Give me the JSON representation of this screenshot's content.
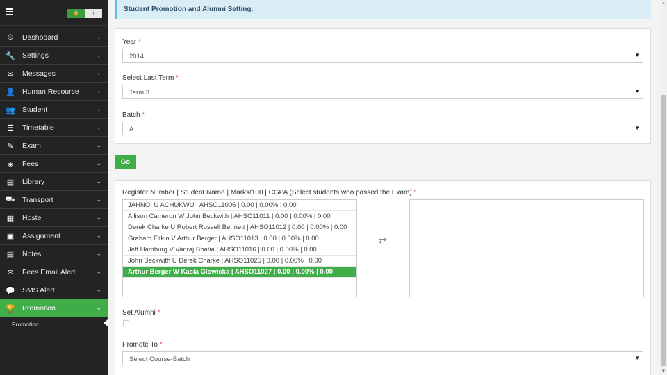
{
  "sidebar": {
    "items": [
      {
        "label": "Dashboard",
        "icon": "dashboard-icon",
        "glyph": "⏲"
      },
      {
        "label": "Settings",
        "icon": "wrench-icon",
        "glyph": "🔧"
      },
      {
        "label": "Messages",
        "icon": "envelope-icon",
        "glyph": "✉"
      },
      {
        "label": "Human Resource",
        "icon": "user-icon",
        "glyph": "👤"
      },
      {
        "label": "Student",
        "icon": "users-icon",
        "glyph": "👥"
      },
      {
        "label": "Timetable",
        "icon": "table-icon",
        "glyph": "☰"
      },
      {
        "label": "Exam",
        "icon": "edit-icon",
        "glyph": "✎"
      },
      {
        "label": "Fees",
        "icon": "tag-icon",
        "glyph": "◈"
      },
      {
        "label": "Library",
        "icon": "book-icon",
        "glyph": "▤"
      },
      {
        "label": "Transport",
        "icon": "truck-icon",
        "glyph": "⛟"
      },
      {
        "label": "Hostel",
        "icon": "building-icon",
        "glyph": "▦"
      },
      {
        "label": "Assignment",
        "icon": "file-icon",
        "glyph": "▣"
      },
      {
        "label": "Notes",
        "icon": "list-icon",
        "glyph": "▤"
      },
      {
        "label": "Fees Email Alert",
        "icon": "envelope-icon",
        "glyph": "✉"
      },
      {
        "label": "SMS Alert",
        "icon": "comment-icon",
        "glyph": "💬"
      },
      {
        "label": "Promotion",
        "icon": "trophy-icon",
        "glyph": "🏆"
      }
    ],
    "active_index": 15,
    "sub_item": "Promotion",
    "chevron": "⌄",
    "lock_glyph": "🔒",
    "info_glyph": "i"
  },
  "header": {
    "title": "Student Promotion and Alumni Setting."
  },
  "form": {
    "year": {
      "label": "Year",
      "value": "2014"
    },
    "last_term": {
      "label": "Select Last Term",
      "value": "Term 3"
    },
    "batch": {
      "label": "Batch",
      "value": "A"
    },
    "required_mark": "*",
    "caret": "▼",
    "go_label": "Go"
  },
  "students": {
    "label": "Register Number | Student Name | Marks/100 | CGPA (Select students who passed the Exam)",
    "options": [
      "JAHNOI U ACHUKWU | AHSO11006 | 0.00 | 0.00% | 0.00",
      "Allison Cameron W John Beckwith | AHSO11011 | 0.00 | 0.00% | 0.00",
      "Derek Charke U Robert Russell Bennett | AHSO11012 | 0.00 | 0.00% | 0.00",
      "Graham Fitkin V Arthur Berger | AHSO11013 | 0.00 | 0.00% | 0.00",
      "Jeff Hamburg V Vanraj Bhatia | AHSO11016 | 0.00 | 0.00% | 0.00",
      "John Beckwith U Derek Charke | AHSO11025 | 0.00 | 0.00% | 0.00",
      "Arthur Berger W Kasia Glowicka | AHSO11027 | 0.00 | 0.00% | 0.00"
    ],
    "selected_index": 6,
    "swap_glyph": "⇄"
  },
  "alumni": {
    "label": "Set Alumni"
  },
  "promote": {
    "label": "Promote To",
    "placeholder": "Select Course-Batch"
  },
  "scrollbar": {
    "up": "▲",
    "down": "▼"
  }
}
